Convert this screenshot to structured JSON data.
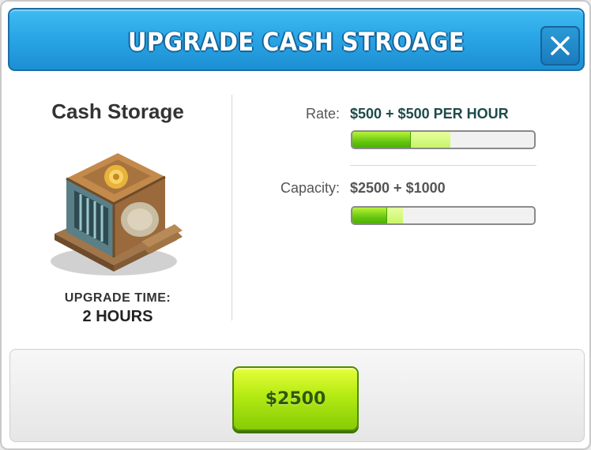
{
  "header": {
    "title": "Upgrade Cash Stroage",
    "close_icon": "close-icon"
  },
  "building": {
    "name": "Cash Storage",
    "image_icon": "cash-storage-building-icon",
    "upgrade_time_label": "UPGRADE TIME:",
    "upgrade_time_value": "2 HOURS"
  },
  "stats": [
    {
      "label": "Rate:",
      "value": "$500 + $500 PER HOUR",
      "value_color": "#1f4a4a",
      "current_fraction": 0.32,
      "upgraded_fraction": 0.54
    },
    {
      "label": "Capacity:",
      "value": "$2500 + $1000",
      "value_color": "#555555",
      "current_fraction": 0.19,
      "upgraded_fraction": 0.28
    }
  ],
  "footer": {
    "buy_label": "$2500"
  },
  "colors": {
    "header_blue": "#2aa6e6",
    "button_green": "#b4ea12",
    "bar_green": "#66c80f"
  }
}
